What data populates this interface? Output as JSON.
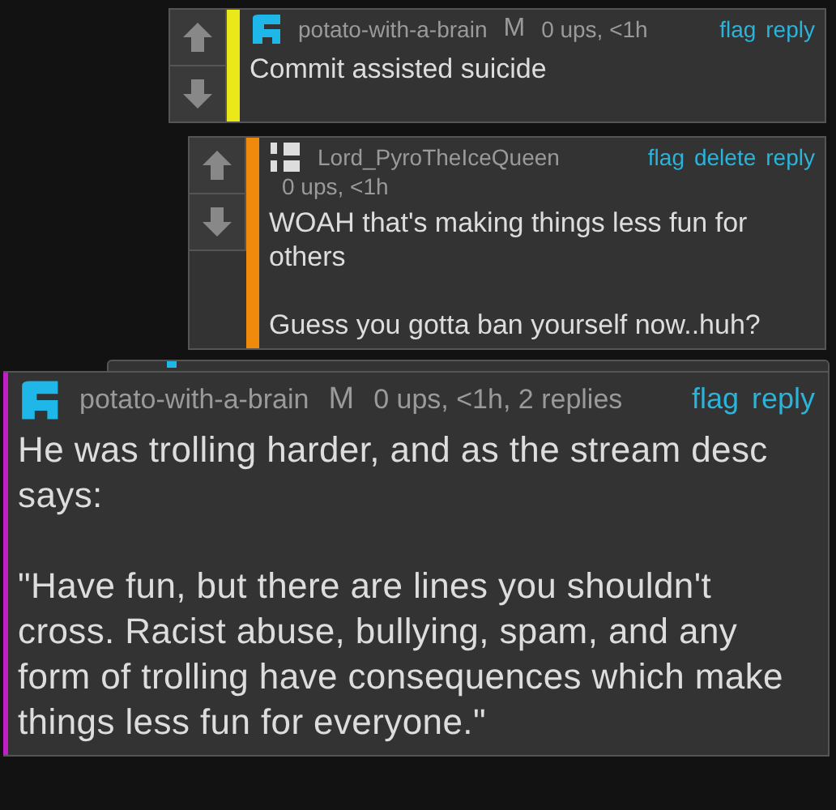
{
  "comments": [
    {
      "kind": "reply",
      "votes": true,
      "color": "#e8e81a",
      "avatar": {
        "kind": "blob"
      },
      "user": "potato-with-a-brain",
      "badge": "M",
      "meta": "0 ups, <1h",
      "actions": [
        "flag",
        "reply"
      ],
      "body": [
        "Commit assisted suicide"
      ]
    },
    {
      "kind": "reply",
      "votes": true,
      "color": "#f08a0c",
      "avatar": {
        "kind": "blocks"
      },
      "user": "Lord_PyroTheIceQueen",
      "meta": "0 ups, <1h",
      "actions": [
        "flag",
        "delete",
        "reply"
      ],
      "body": [
        "WOAH that's making things less fun for others",
        "Guess you gotta ban yourself now..huh?"
      ]
    },
    {
      "kind": "top",
      "votes": false,
      "color": "#c21ec8",
      "avatar": {
        "kind": "blob"
      },
      "user": "potato-with-a-brain",
      "badge": "M",
      "meta": "0 ups, <1h, 2 replies",
      "actions": [
        "flag",
        "reply"
      ],
      "body": [
        "He was trolling harder, and as the stream desc says:",
        "\"Have fun, but there are lines you shouldn't cross. Racist abuse, bullying, spam, and any form of trolling have consequences which make things less fun for everyone.\""
      ]
    }
  ]
}
